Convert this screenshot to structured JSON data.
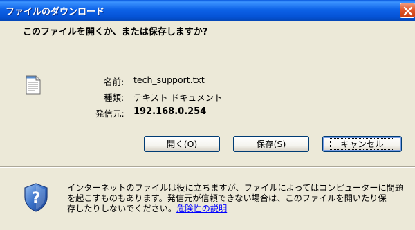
{
  "window": {
    "title": "ファイルのダウンロード"
  },
  "dialog": {
    "question": "このファイルを開くか、または保存しますか?",
    "file": {
      "name_label": "名前:",
      "name_value": "tech_support.txt",
      "type_label": "種類:",
      "type_value": "テキスト ドキュメント",
      "from_label": "発信元:",
      "from_value": "192.168.0.254"
    },
    "buttons": {
      "open_label": "開く(",
      "open_mnemonic": "O",
      "open_suffix": ")",
      "save_label": "保存(",
      "save_mnemonic": "S",
      "save_suffix": ")",
      "cancel_label": "キャンセル"
    },
    "warning": {
      "text_line1": "インターネットのファイルは役に立ちますが、ファイルによってはコンピューターに問題",
      "text_line2": "を起こすものもあります。発信元が信頼できない場合は、このファイルを開いたり保",
      "text_line3": "存したりしないでください。",
      "link": "危険性の説明"
    }
  },
  "icons": {
    "file": "text-file-icon",
    "shield": "security-shield-icon",
    "close": "close-icon"
  },
  "colors": {
    "titlebar": "#0553D6",
    "close": "#E1582B",
    "link": "#0000FF",
    "dialog_bg": "#ECE9D8"
  }
}
